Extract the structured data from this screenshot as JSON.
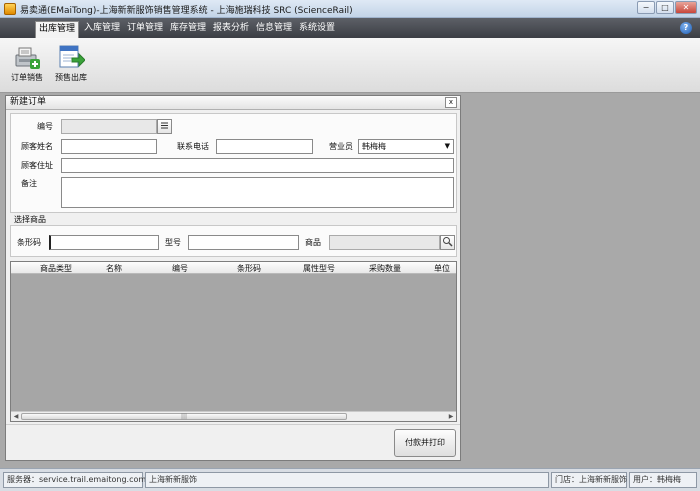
{
  "window": {
    "title": "易卖通(EMaiTong)-上海新新服饰销售管理系统 - 上海施瑞科技 SRC  (ScienceRail)",
    "buttons": [
      "−",
      "□",
      "✕"
    ]
  },
  "menu": {
    "items": [
      "出库管理",
      "入库管理",
      "订单管理",
      "库存管理",
      "报表分析",
      "信息管理",
      "系统设置"
    ],
    "active_index": 0,
    "help_label": "?"
  },
  "toolbar": {
    "order_sale_label": "订单销售",
    "presale_out_label": "预售出库"
  },
  "new_order": {
    "title": "新建订单",
    "close_label": "x",
    "fields": {
      "number_label": "编号",
      "number_value": "",
      "customer_name_label": "顾客姓名",
      "customer_name_value": "",
      "phone_label": "联系电话",
      "phone_value": "",
      "salesperson_label": "营业员",
      "salesperson_value": "韩梅梅",
      "address_label": "顾客住址",
      "address_value": "",
      "note_label": "备注",
      "note_value": ""
    },
    "select_product": {
      "title": "选择商品",
      "barcode_label": "条形码",
      "model_label": "型号",
      "product_label": "商品"
    },
    "grid": {
      "columns": [
        "商品类型",
        "名称",
        "编号",
        "条形码",
        "属性型号",
        "采购数量",
        "单位"
      ],
      "scroll_grip": "|||"
    },
    "pay_print_label": "付款并打印"
  },
  "statusbar": {
    "server": "服务器：service.trail.emaitong.com",
    "company": "上海新新服饰",
    "store": "门店：上海新新服饰",
    "user": "用户：韩梅梅"
  }
}
